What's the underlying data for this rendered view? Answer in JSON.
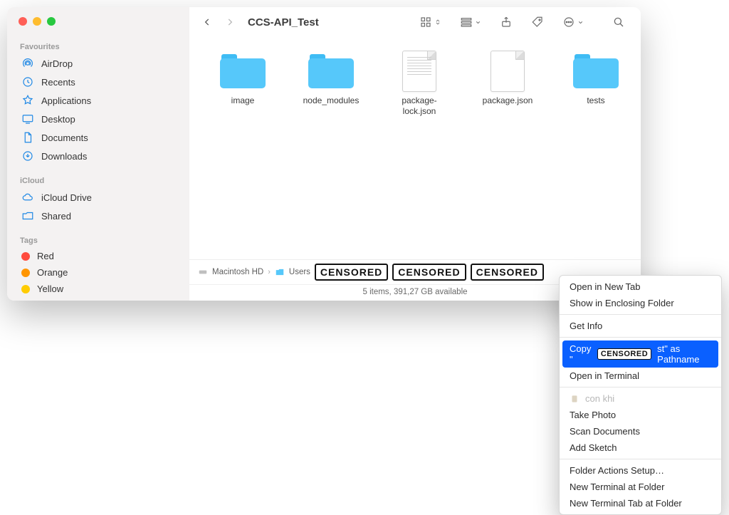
{
  "window_title": "CCS-API_Test",
  "traffic_lights": [
    "close",
    "minimize",
    "zoom"
  ],
  "sidebar": {
    "favourites_label": "Favourites",
    "favourites": [
      {
        "icon": "airdrop",
        "label": "AirDrop"
      },
      {
        "icon": "recents",
        "label": "Recents"
      },
      {
        "icon": "applications",
        "label": "Applications"
      },
      {
        "icon": "desktop",
        "label": "Desktop"
      },
      {
        "icon": "documents",
        "label": "Documents"
      },
      {
        "icon": "downloads",
        "label": "Downloads"
      }
    ],
    "icloud_label": "iCloud",
    "icloud": [
      {
        "icon": "icloud-drive",
        "label": "iCloud Drive"
      },
      {
        "icon": "shared",
        "label": "Shared"
      }
    ],
    "tags_label": "Tags",
    "tags": [
      {
        "color": "#ff4b3e",
        "label": "Red"
      },
      {
        "color": "#ff9500",
        "label": "Orange"
      },
      {
        "color": "#ffcc02",
        "label": "Yellow"
      }
    ]
  },
  "items": [
    {
      "type": "folder",
      "label": "image"
    },
    {
      "type": "folder",
      "label": "node_modules"
    },
    {
      "type": "text-file",
      "label": "package-lock.json"
    },
    {
      "type": "blank-file",
      "label": "package.json"
    },
    {
      "type": "folder",
      "label": "tests"
    }
  ],
  "pathbar": {
    "root": "Macintosh HD",
    "users": "Users",
    "censored": [
      "CENSORED",
      "CENSORED",
      "CENSORED"
    ]
  },
  "status": "5 items, 391,27 GB available",
  "context_menu": {
    "open_new_tab": "Open in New Tab",
    "show_enclosing": "Show in Enclosing Folder",
    "get_info": "Get Info",
    "copy_pathname_prefix": "Copy \"",
    "copy_pathname_censored": "CENSORED",
    "copy_pathname_suffix": "st\" as Pathname",
    "open_terminal": "Open in Terminal",
    "con_khi": "con khi",
    "take_photo": "Take Photo",
    "scan_documents": "Scan Documents",
    "add_sketch": "Add Sketch",
    "folder_actions": "Folder Actions Setup…",
    "new_terminal_at": "New Terminal at Folder",
    "new_terminal_tab": "New Terminal Tab at Folder"
  }
}
